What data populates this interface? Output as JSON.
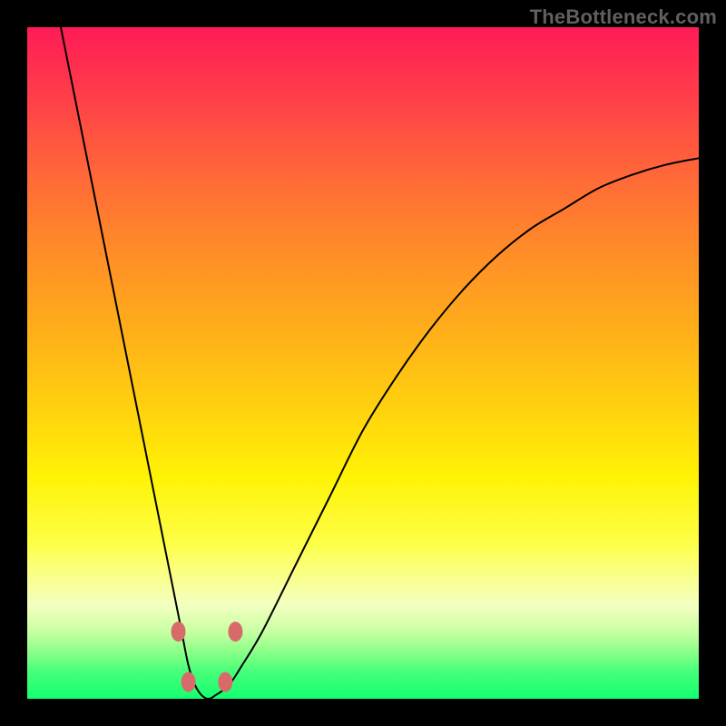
{
  "watermark": "TheBottleneck.com",
  "chart_data": {
    "type": "line",
    "title": "",
    "xlabel": "",
    "ylabel": "",
    "xlim": [
      0,
      100
    ],
    "ylim": [
      0,
      100
    ],
    "grid": false,
    "series": [
      {
        "name": "curve",
        "x": [
          5,
          6,
          7,
          8,
          10,
          12,
          14,
          16,
          18,
          20,
          22,
          23,
          24,
          25,
          26,
          27,
          28,
          30,
          32,
          35,
          40,
          45,
          50,
          55,
          60,
          65,
          70,
          75,
          80,
          85,
          90,
          95,
          100
        ],
        "values": [
          100,
          95,
          90,
          85,
          75,
          65,
          55,
          45,
          35,
          25,
          15,
          10,
          5,
          2,
          0.5,
          0,
          0.5,
          2,
          5,
          10,
          20,
          30,
          40,
          48,
          55,
          61,
          66,
          70,
          73,
          76,
          78,
          79.5,
          80.5
        ]
      }
    ],
    "markers": [
      {
        "x": 22.5,
        "y": 10
      },
      {
        "x": 31.0,
        "y": 10
      },
      {
        "x": 24.0,
        "y": 2.5
      },
      {
        "x": 29.5,
        "y": 2.5
      }
    ],
    "background_gradient": {
      "top": "#ff1b56",
      "middle": "#ffd20e",
      "bottom": "#14ff6f"
    }
  }
}
